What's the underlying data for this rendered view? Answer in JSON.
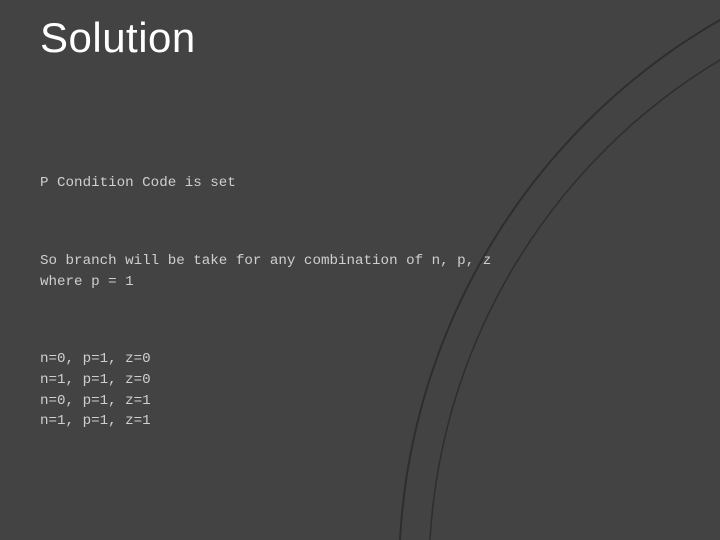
{
  "title": "Solution",
  "line1": "P Condition Code is set",
  "line2": "So branch will be take for any combination of n, p, z\nwhere p = 1",
  "combos": "n=0, p=1, z=0\nn=1, p=1, z=0\nn=0, p=1, z=1\nn=1, p=1, z=1"
}
